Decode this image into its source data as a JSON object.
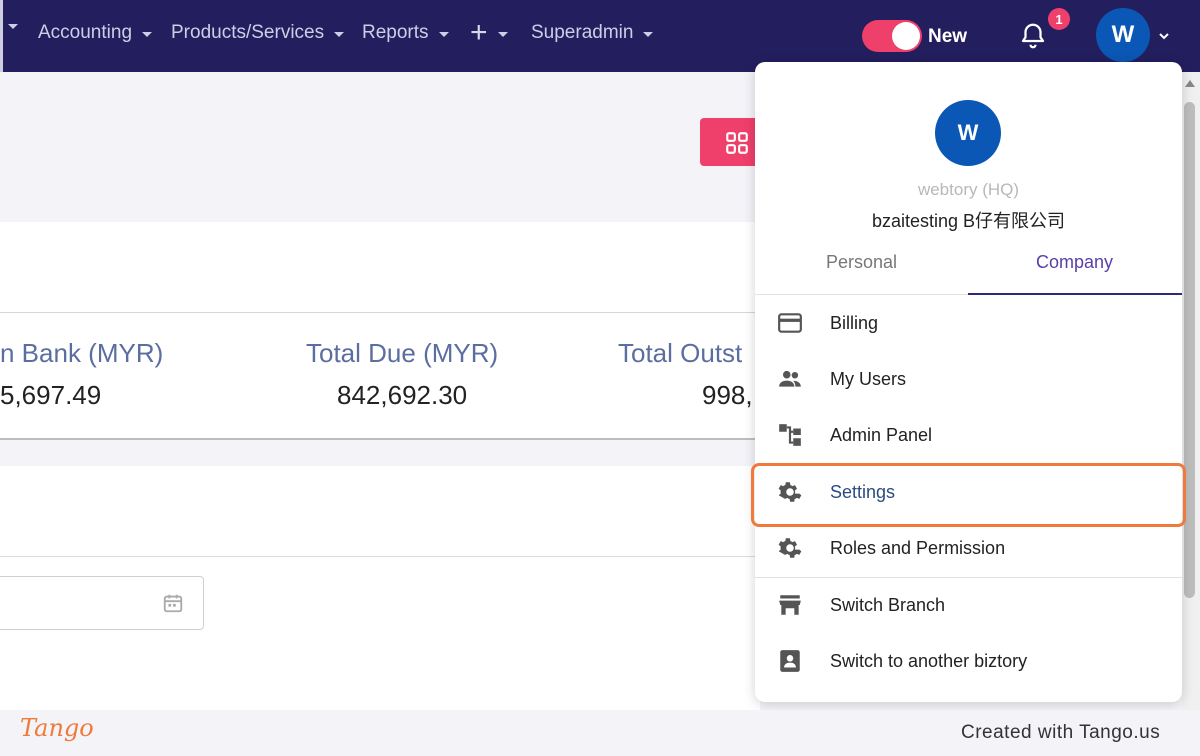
{
  "nav": {
    "items": [
      {
        "label": "Accounting"
      },
      {
        "label": "Products/Services"
      },
      {
        "label": "Reports"
      },
      {
        "label": "+"
      },
      {
        "label": "Superadmin"
      }
    ],
    "toggle_label": "New",
    "toggle_on": true,
    "notification_count": "1",
    "avatar_initial": "W"
  },
  "stats": [
    {
      "label": "n Bank (MYR)",
      "value": "5,697.49"
    },
    {
      "label": "Total Due (MYR)",
      "value": "842,692.30"
    },
    {
      "label": "Total Outst",
      "value": "998,"
    }
  ],
  "dropdown": {
    "avatar_initial": "W",
    "subtitle": "webtory (HQ)",
    "company_name": "bzaitesting B仔有限公司",
    "tabs": [
      {
        "label": "Personal"
      },
      {
        "label": "Company"
      }
    ],
    "active_tab": "Company",
    "menu": [
      {
        "label": "Billing",
        "icon": "credit-card-icon"
      },
      {
        "label": "My Users",
        "icon": "users-icon"
      },
      {
        "label": "Admin Panel",
        "icon": "sitemap-icon"
      },
      {
        "label": "Settings",
        "icon": "gear-icon"
      },
      {
        "label": "Roles and Permission",
        "icon": "gear-icon"
      },
      {
        "label": "Switch Branch",
        "icon": "store-icon"
      },
      {
        "label": "Switch to another biztory",
        "icon": "contact-icon"
      }
    ],
    "highlighted_item": "Settings"
  },
  "footer": {
    "logo": "Tango",
    "credit": "Created with Tango.us"
  },
  "colors": {
    "nav_bg": "#231e5e",
    "accent_pink": "#ef3f6b",
    "avatar_blue": "#0b57b5",
    "highlight_orange": "#f0793c"
  }
}
